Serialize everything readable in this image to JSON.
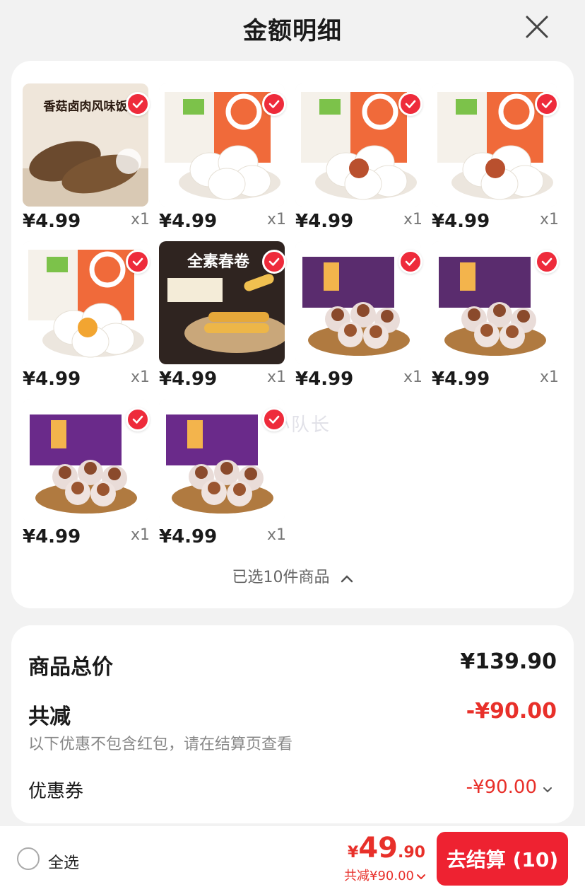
{
  "header": {
    "title": "金额明细",
    "close_icon": "close-icon"
  },
  "products": [
    {
      "price": "¥4.99",
      "qty": "x1",
      "theme": "rice"
    },
    {
      "price": "¥4.99",
      "qty": "x1",
      "theme": "bun-white"
    },
    {
      "price": "¥4.99",
      "qty": "x1",
      "theme": "bun-filled"
    },
    {
      "price": "¥4.99",
      "qty": "x1",
      "theme": "bun-filled"
    },
    {
      "price": "¥4.99",
      "qty": "x1",
      "theme": "bun-yellow"
    },
    {
      "price": "¥4.99",
      "qty": "x1",
      "theme": "spring-roll"
    },
    {
      "price": "¥4.99",
      "qty": "x1",
      "theme": "shaomai"
    },
    {
      "price": "¥4.99",
      "qty": "x1",
      "theme": "shaomai"
    },
    {
      "price": "¥4.99",
      "qty": "x1",
      "theme": "shaomai-purple"
    },
    {
      "price": "¥4.99",
      "qty": "x1",
      "theme": "shaomai-purple"
    }
  ],
  "product_labels": {
    "rice": "香菇卤肉风味饭",
    "spring-roll": "全素春卷"
  },
  "selected_summary": "已选10件商品",
  "watermark": "羊毛小队长",
  "totals": {
    "goods_total_label": "商品总价",
    "goods_total_value": "¥139.90",
    "reduction_label": "共减",
    "reduction_value": "-¥90.00",
    "note": "以下优惠不包含红包，请在结算页查看",
    "coupon_label": "优惠券",
    "coupon_value": "-¥90.00"
  },
  "bottom": {
    "select_all": "全选",
    "currency": "¥",
    "pay_int": "49",
    "pay_dec": ".90",
    "discount_line": "共减¥90.00",
    "checkout_label": "去结算 (10)"
  },
  "colors": {
    "accent": "#ee2231",
    "price_red": "#e8302a"
  }
}
